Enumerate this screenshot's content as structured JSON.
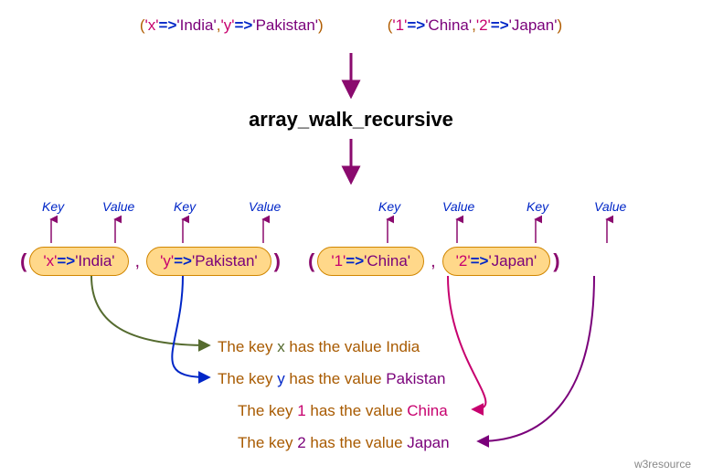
{
  "top_arrays": {
    "left": {
      "open": "(",
      "close": ")",
      "p1k": "'x'",
      "p1a": "=>",
      "p1v": "'India'",
      "sep": ",",
      "p2k": "'y'",
      "p2a": "=>",
      "p2v": "'Pakistan'"
    },
    "right": {
      "open": "(",
      "close": ")",
      "p1k": "'1'",
      "p1a": "=>",
      "p1v": "'China'",
      "sep": ",",
      "p2k": "'2'",
      "p2a": "=>",
      "p2v": "'Japan'"
    }
  },
  "function_name": "array_walk_recursive",
  "labels": {
    "key": "Key",
    "value": "Value"
  },
  "box_pairs": {
    "p1": {
      "k": "'x'",
      "a": "=>",
      "v": "'India'"
    },
    "p2": {
      "k": "'y'",
      "a": "=>",
      "v": "'Pakistan'"
    },
    "p3": {
      "k": "'1'",
      "a": "=>",
      "v": "'China'"
    },
    "p4": {
      "k": "'2'",
      "a": "=>",
      "v": "'Japan'"
    }
  },
  "outputs": {
    "o1": {
      "pre": "The key ",
      "k": "x",
      "mid": " has the value ",
      "v": "India"
    },
    "o2": {
      "pre": "The key ",
      "k": "y",
      "mid": " has the value ",
      "v": "Pakistan"
    },
    "o3": {
      "pre": "The key ",
      "k": "1",
      "mid": " has the value ",
      "v": "China"
    },
    "o4": {
      "pre": "The key ",
      "k": "2",
      "mid": " has the value ",
      "v": "Japan"
    }
  },
  "watermark": "w3resource"
}
